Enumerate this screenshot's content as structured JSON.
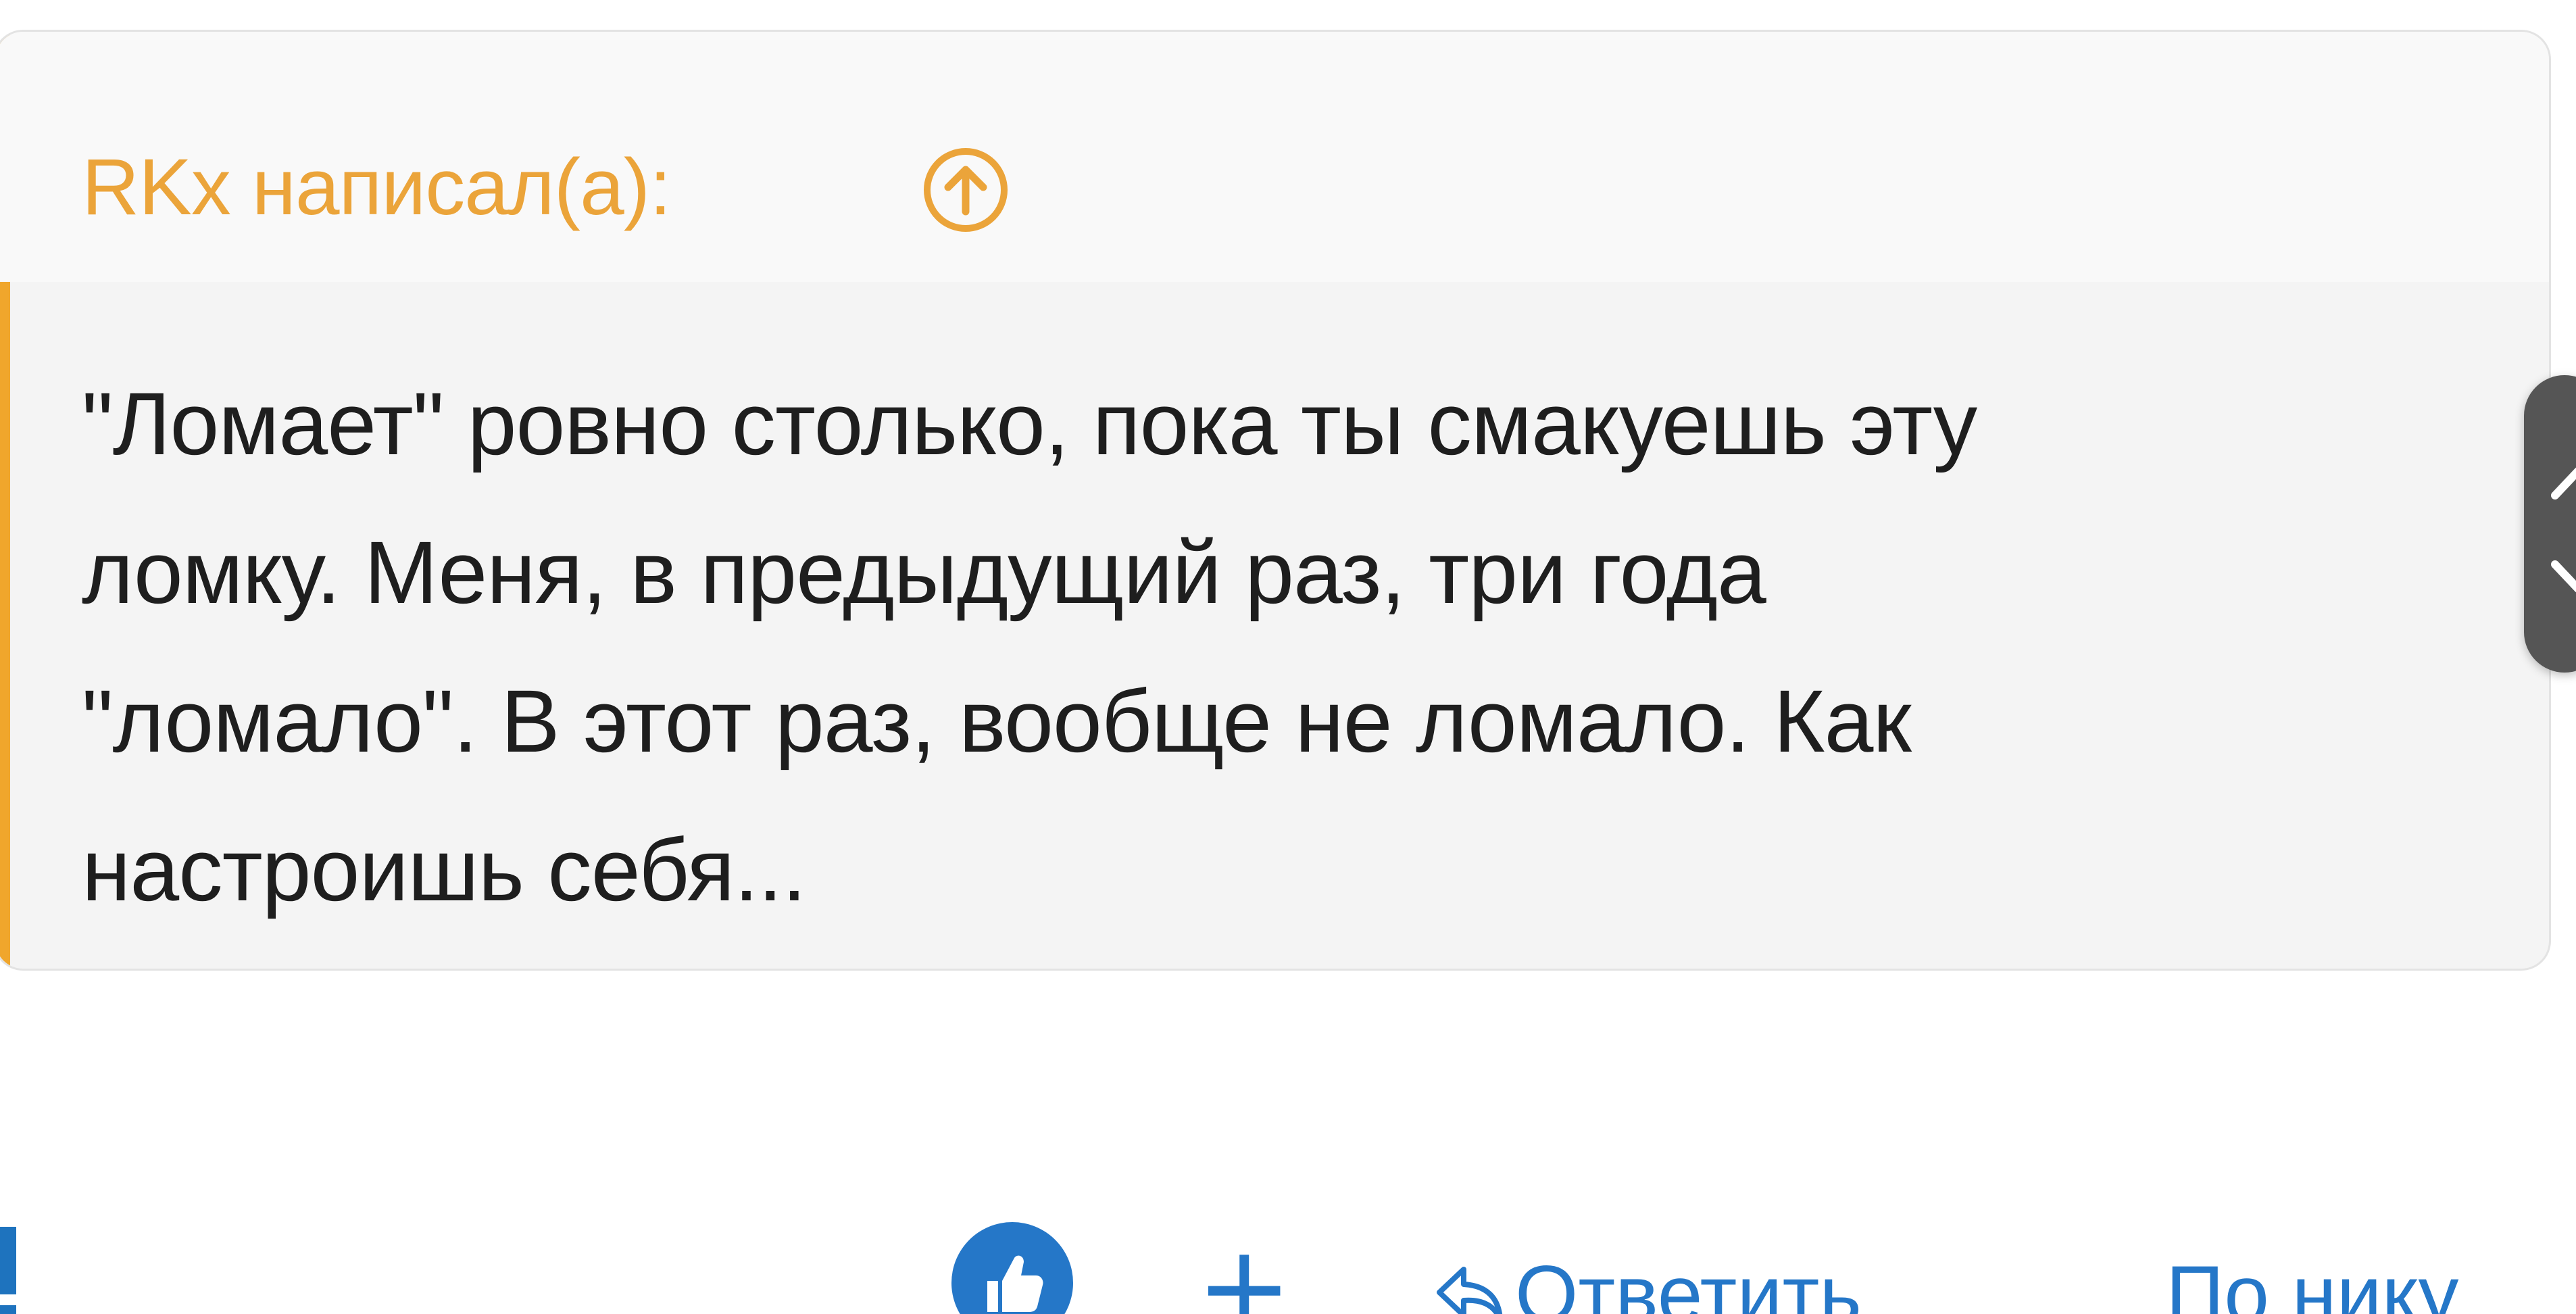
{
  "quote": {
    "author_line": "RKx написал(а):",
    "up_icon": "arrow-up-circle-icon",
    "body": "\"Ломает\" ровно столько, пока ты смакуешь эту\nломку. Меня, в предыдущий раз, три года\n\"ломало\". В этот раз, вообще не ломало. Как\nнастроишь себя...",
    "accent_color": "#f0a62c"
  },
  "actions": {
    "like_icon": "thumbs-up-icon",
    "plus_label": "+",
    "reply_label": "Ответить",
    "nick_label": "По нику",
    "link_color": "#2577c8"
  },
  "scroll_handle": {
    "icon": "chevron-up-down-icon"
  }
}
